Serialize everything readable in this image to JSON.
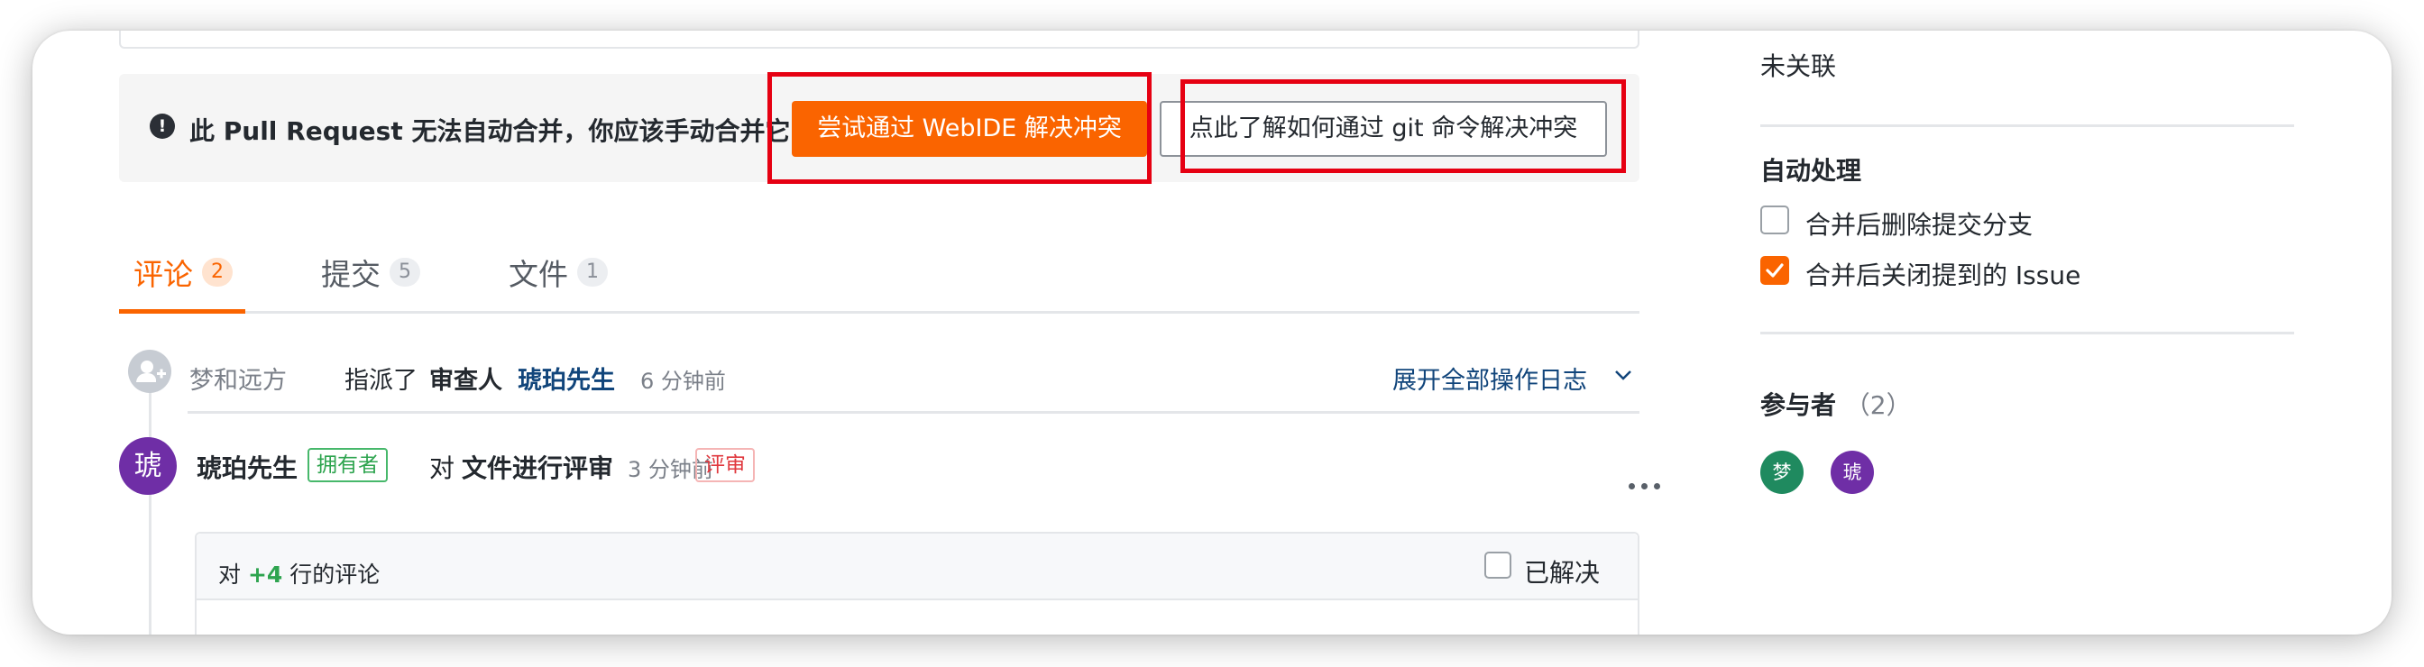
{
  "merge_notice": {
    "icon": "exclamation-circle-icon",
    "text": "此 Pull Request 无法自动合并，你应该手动合并它",
    "webide_button": "尝试通过 WebIDE 解决冲突",
    "git_help_button": "点此了解如何通过 git 命令解决冲突"
  },
  "tabs": [
    {
      "label": "评论",
      "count": "2",
      "active": true
    },
    {
      "label": "提交",
      "count": "5"
    },
    {
      "label": "文件",
      "count": "1"
    }
  ],
  "activity": {
    "actor": "梦和远方",
    "action": "指派了",
    "role": "审查人",
    "target": "琥珀先生",
    "time": "6 分钟前",
    "expand_log": "展开全部操作日志"
  },
  "review": {
    "avatar_char": "琥",
    "author": "琥珀先生",
    "owner_badge": "拥有者",
    "prefix": "对",
    "action": "文件进行评审",
    "time": "3 分钟前",
    "type_badge": "评审"
  },
  "comment_box": {
    "prefix": "对",
    "lines": "+4",
    "suffix": "行的评论",
    "resolved_label": "已解决"
  },
  "sidebar": {
    "linked_value": "未关联",
    "auto_title": "自动处理",
    "options": [
      {
        "label": "合并后删除提交分支",
        "checked": false
      },
      {
        "label": "合并后关闭提到的 Issue",
        "checked": true
      }
    ],
    "participants_title": "参与者",
    "participants_count": "（2）",
    "participants": [
      {
        "char": "梦",
        "color": "#1f8a5f"
      },
      {
        "char": "琥",
        "color": "#6f2ea6"
      }
    ]
  },
  "colors": {
    "accent": "#fa6400",
    "link": "#11457b",
    "highlight_box": "#e60012"
  }
}
